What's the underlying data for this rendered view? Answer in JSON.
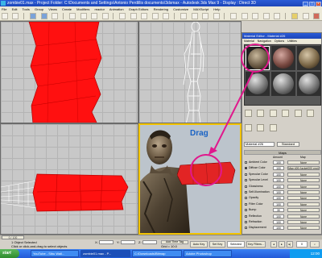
{
  "window": {
    "title": "zombie01.max   - Project Folder: C:\\Documents and Settings\\Antonio Perdillis documents\\3dsmax   - Autodesk 3ds Max 9   - Display : Direct 3D"
  },
  "menu": {
    "items": [
      "File",
      "Edit",
      "Tools",
      "Group",
      "Views",
      "Create",
      "Modifiers",
      "reactor",
      "Animation",
      "Graph Editors",
      "Rendering",
      "Customize",
      "MAXScript",
      "Help"
    ]
  },
  "overlay": {
    "drag_label": "Drag"
  },
  "material_editor": {
    "title": "Material Editor - Material #26",
    "menu": [
      "Material",
      "Navigation",
      "Options",
      "Utilities"
    ],
    "name_value": "Material #26",
    "type_label": "Standard",
    "maps_header": "Maps",
    "col_amount": "Amount",
    "col_map": "Map",
    "rows": [
      {
        "label": "Ambient Color",
        "amount": "100",
        "map": "None",
        "checked": false
      },
      {
        "label": "Diffuse Color",
        "amount": "100",
        "map": "Map #26 (jacket000.png)",
        "checked": true
      },
      {
        "label": "Specular Color",
        "amount": "100",
        "map": "None",
        "checked": false
      },
      {
        "label": "Specular Level",
        "amount": "100",
        "map": "None",
        "checked": false
      },
      {
        "label": "Glossiness",
        "amount": "100",
        "map": "None",
        "checked": false
      },
      {
        "label": "Self-Illumination",
        "amount": "100",
        "map": "None",
        "checked": false
      },
      {
        "label": "Opacity",
        "amount": "100",
        "map": "None",
        "checked": false
      },
      {
        "label": "Filter Color",
        "amount": "100",
        "map": "None",
        "checked": false
      },
      {
        "label": "Bump",
        "amount": "30",
        "map": "None",
        "checked": false
      },
      {
        "label": "Reflection",
        "amount": "100",
        "map": "None",
        "checked": false
      },
      {
        "label": "Refraction",
        "amount": "100",
        "map": "None",
        "checked": false
      },
      {
        "label": "Displacement",
        "amount": "100",
        "map": "None",
        "checked": false
      }
    ]
  },
  "timeline": {
    "slider_label": "0 / 100"
  },
  "status": {
    "selection": "1 Object Selected",
    "prompt": "Click or click-and-drag to select objects",
    "x_label": "X:",
    "y_label": "Y:",
    "z_label": "Z:",
    "grid_label": "Grid = 10.0",
    "auto_key": "Auto Key",
    "set_key": "Set Key",
    "selected": "Selected",
    "key_filters": "Key Filters...",
    "add_time_tag": "Add Time Tag"
  },
  "taskbar": {
    "start": "start",
    "tasks": [
      "YouTube - Sibu Wall...",
      "zombie01.max - P...",
      "C:\\Downloads\\Bitmap",
      "Adobe Photoshop"
    ],
    "clock": "12:00"
  },
  "colors": {
    "mesh_red": "#ff1010",
    "highlight_magenta": "#e0188c",
    "drag_blue": "#1a63c4"
  }
}
